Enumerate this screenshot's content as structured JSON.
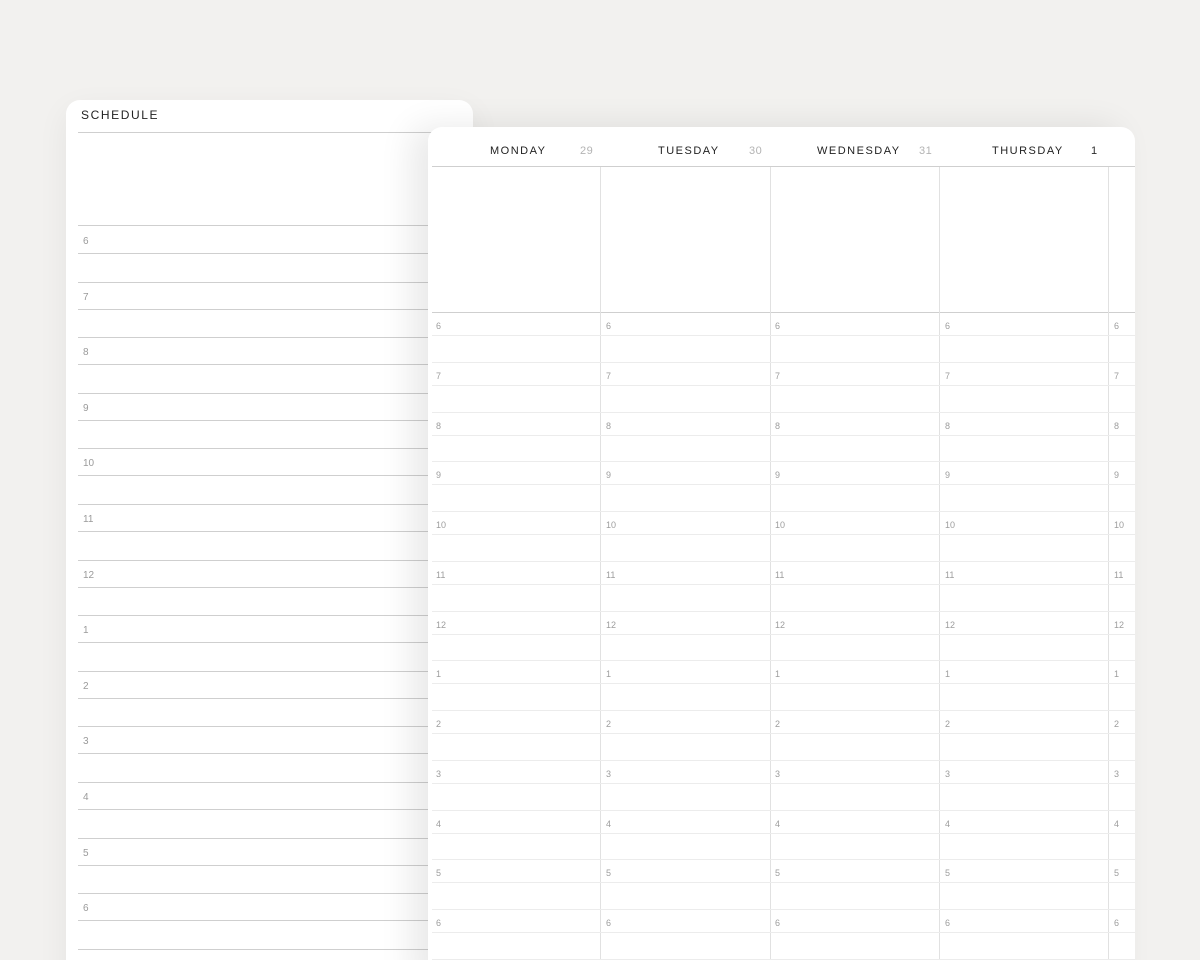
{
  "schedule": {
    "title": "SCHEDULE",
    "hours": [
      "6",
      "7",
      "8",
      "9",
      "10",
      "11",
      "12",
      "1",
      "2",
      "3",
      "4",
      "5",
      "6"
    ]
  },
  "week": {
    "days": [
      {
        "name": "MONDAY",
        "number": "29"
      },
      {
        "name": "TUESDAY",
        "number": "30"
      },
      {
        "name": "WEDNESDAY",
        "number": "31"
      },
      {
        "name": "THURSDAY",
        "number": "1"
      }
    ],
    "hours": [
      "6",
      "7",
      "8",
      "9",
      "10",
      "11",
      "12",
      "1",
      "2",
      "3",
      "4",
      "5",
      "6"
    ]
  },
  "colors": {
    "background": "#f2f1ef",
    "page": "#ffffff",
    "rule": "#cfcfcf",
    "label": "#9a9a9a"
  }
}
